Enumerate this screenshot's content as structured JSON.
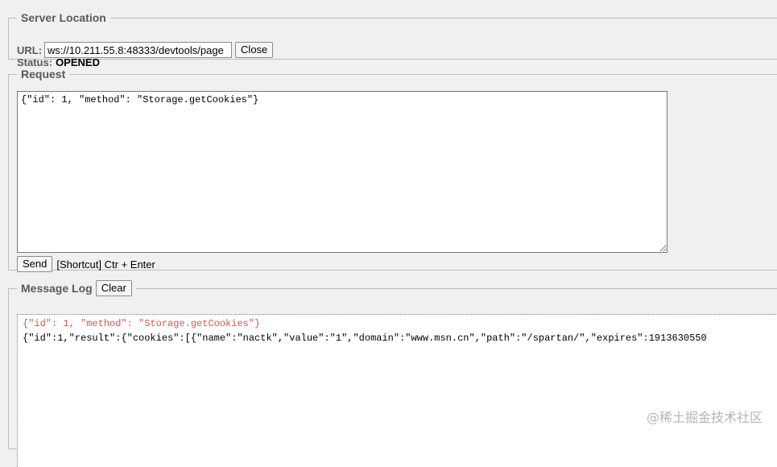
{
  "server": {
    "legend": "Server Location",
    "url_label": "URL:",
    "url_value": "ws://10.211.55.8:48333/devtools/page",
    "close_label": "Close",
    "status_label": "Status:",
    "status_value": "OPENED"
  },
  "request": {
    "legend": "Request",
    "body": "{\"id\": 1, \"method\": \"Storage.getCookies\"}",
    "send_label": "Send",
    "shortcut_text": "[Shortcut] Ctr + Enter"
  },
  "log": {
    "legend": "Message Log",
    "clear_label": "Clear",
    "entries": [
      "{\"id\": 1, \"method\": \"Storage.getCookies\"}",
      "{\"id\":1,\"result\":{\"cookies\":[{\"name\":\"nactk\",\"value\":\"1\",\"domain\":\"www.msn.cn\",\"path\":\"/spartan/\",\"expires\":1913630550"
    ]
  },
  "colors": {
    "sent_message": "#d9534f",
    "legend_text": "#5a5a5a"
  },
  "watermark": "@稀土掘金技术社区"
}
